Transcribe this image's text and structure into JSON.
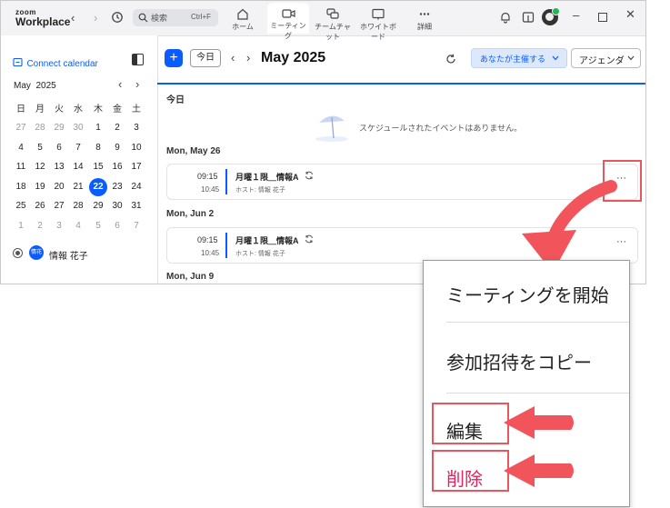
{
  "titlebar": {
    "logo_top": "zoom",
    "logo_bottom": "Workplace",
    "search_placeholder": "検索",
    "search_shortcut": "Ctrl+F",
    "tabs": [
      {
        "label": "ホーム",
        "icon": "home-icon"
      },
      {
        "label": "ミーティング",
        "icon": "video-icon"
      },
      {
        "label": "チームチャット",
        "icon": "chat-icon"
      },
      {
        "label": "ホワイトボード",
        "icon": "whiteboard-icon"
      },
      {
        "label": "詳細",
        "icon": "more-icon"
      }
    ]
  },
  "sidebar": {
    "connect_calendar": "Connect calendar",
    "month_label": "May",
    "year_label": "2025",
    "weekdays": [
      "日",
      "月",
      "火",
      "水",
      "木",
      "金",
      "土"
    ],
    "weeks": [
      [
        "27",
        "28",
        "29",
        "30",
        "1",
        "2",
        "3"
      ],
      [
        "4",
        "5",
        "6",
        "7",
        "8",
        "9",
        "10"
      ],
      [
        "11",
        "12",
        "13",
        "14",
        "15",
        "16",
        "17"
      ],
      [
        "18",
        "19",
        "20",
        "21",
        "22",
        "23",
        "24"
      ],
      [
        "25",
        "26",
        "27",
        "28",
        "29",
        "30",
        "31"
      ],
      [
        "1",
        "2",
        "3",
        "4",
        "5",
        "6",
        "7"
      ]
    ],
    "selected_day": "22",
    "calendar_owner_badge": "情花",
    "calendar_owner_name": "情報 花子"
  },
  "toolbar": {
    "today_button": "今日",
    "title": "May 2025",
    "host_filter": "あなたが主催する",
    "view_select": "アジェンダ"
  },
  "agenda": {
    "today_label": "今日",
    "empty_message": "スケジュールされたイベントはありません。",
    "days": [
      {
        "date": "Mon, May 26",
        "start": "09:15",
        "end": "10:45",
        "title": "月曜１限＿情報A",
        "host": "ホスト: 情報 花子"
      },
      {
        "date": "Mon, Jun 2",
        "start": "09:15",
        "end": "10:45",
        "title": "月曜１限＿情報A",
        "host": "ホスト: 情報 花子"
      }
    ],
    "next_date": "Mon, Jun 9",
    "more_label": "···"
  },
  "context_menu": {
    "start_meeting": "ミーティングを開始",
    "copy_invite": "参加招待をコピー",
    "edit": "編集",
    "delete": "削除"
  },
  "colors": {
    "accent": "#0b5cff",
    "annotation": "#e8575f",
    "delete": "#e0245e"
  }
}
